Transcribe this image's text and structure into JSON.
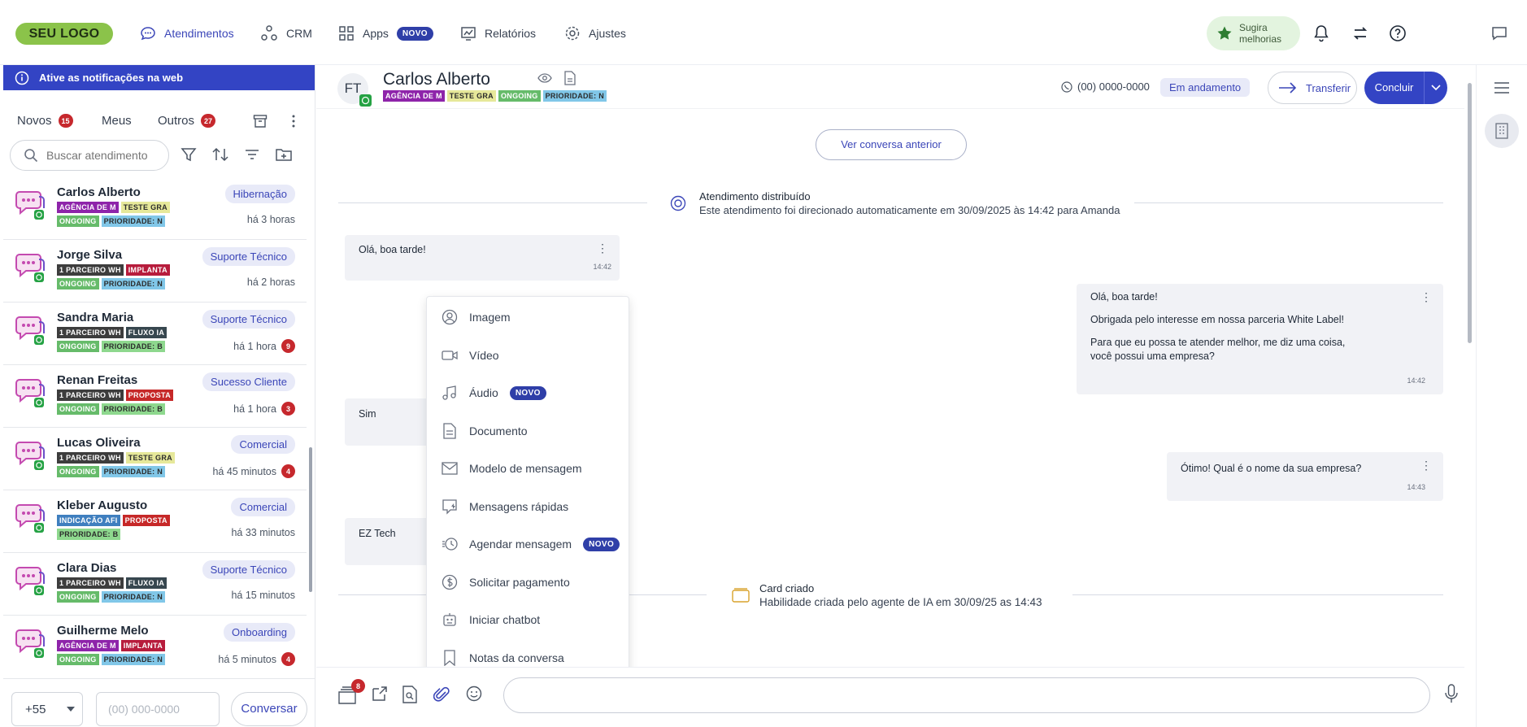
{
  "logo": "SEU LOGO",
  "nav": {
    "items": [
      {
        "label": "Atendimentos",
        "icon": "chat-bubble-icon",
        "active": true
      },
      {
        "label": "CRM",
        "icon": "nodes-icon"
      },
      {
        "label": "Apps",
        "icon": "grid-icon",
        "badge": "NOVO"
      },
      {
        "label": "Relatórios",
        "icon": "chart-icon"
      },
      {
        "label": "Ajustes",
        "icon": "gear-icon"
      }
    ],
    "suggest": {
      "line1": "Sugira",
      "line2": "melhorias"
    }
  },
  "notice": "Ative as notificações na web",
  "tabs": [
    {
      "label": "Novos",
      "count": "15"
    },
    {
      "label": "Meus"
    },
    {
      "label": "Outros",
      "count": "27"
    }
  ],
  "search": {
    "placeholder": "Buscar atendimento"
  },
  "conversations": [
    {
      "name": "Carlos Alberto",
      "tags": [
        "AGÊNCIA DE M",
        "TESTE GRA",
        "ONGOING",
        "PRIORIDADE: N"
      ],
      "status": "Hibernação",
      "time": "há 3 horas"
    },
    {
      "name": "Jorge Silva",
      "tags": [
        "1 PARCEIRO WH",
        "IMPLANTA",
        "ONGOING",
        "PRIORIDADE: N"
      ],
      "status": "Suporte Técnico",
      "time": "há 2 horas"
    },
    {
      "name": "Sandra Maria",
      "tags": [
        "1 PARCEIRO WH",
        "FLUXO IA",
        "ONGOING",
        "PRIORIDADE: B"
      ],
      "status": "Suporte Técnico",
      "time": "há 1 hora",
      "unread": "9"
    },
    {
      "name": "Renan Freitas",
      "tags": [
        "1 PARCEIRO WH",
        "PROPOSTA",
        "ONGOING",
        "PRIORIDADE: B"
      ],
      "status": "Sucesso Cliente",
      "time": "há 1 hora",
      "unread": "3"
    },
    {
      "name": "Lucas Oliveira",
      "tags": [
        "1 PARCEIRO WH",
        "TESTE GRA",
        "ONGOING",
        "PRIORIDADE: N"
      ],
      "status": "Comercial",
      "time": "há 45 minutos",
      "unread": "4"
    },
    {
      "name": "Kleber Augusto",
      "tags": [
        "INDICAÇÃO AFI",
        "PROPOSTA",
        "PRIORIDADE: B"
      ],
      "status": "Comercial",
      "time": "há 33 minutos"
    },
    {
      "name": "Clara Dias",
      "tags": [
        "1 PARCEIRO WH",
        "FLUXO IA",
        "ONGOING",
        "PRIORIDADE: N"
      ],
      "status": "Suporte Técnico",
      "time": "há 15 minutos"
    },
    {
      "name": "Guilherme Melo",
      "tags": [
        "AGÊNCIA DE M",
        "IMPLANTA",
        "ONGOING",
        "PRIORIDADE: N"
      ],
      "status": "Onboarding",
      "time": "há 5 minutos",
      "unread": "4"
    }
  ],
  "tag_colors": {
    "AGÊNCIA DE M": "#8e24aa",
    "TESTE GRA": "#e6e89a",
    "ONGOING": "#66bb6a",
    "PRIORIDADE: N": "#81c7e8",
    "PRIORIDADE: B": "#8ed88e",
    "1 PARCEIRO WH": "#3d3d3d",
    "IMPLANTA": "#b71c3c",
    "FLUXO IA": "#37474f",
    "PROPOSTA": "#c62828",
    "INDICAÇÃO AFI": "#3f7fbf"
  },
  "phone_bar": {
    "ddi": "+55",
    "placeholder": "(00) 000-0000",
    "button": "Conversar"
  },
  "chat": {
    "initials": "FT",
    "name": "Carlos Alberto",
    "tags": [
      "AGÊNCIA DE M",
      "TESTE GRA",
      "ONGOING",
      "PRIORIDADE: N"
    ],
    "phone": "(00) 0000-0000",
    "status": "Em andamento",
    "transfer": "Transferir",
    "finish": "Concluir",
    "prev_button": "Ver conversa anterior",
    "distributed": {
      "title": "Atendimento distribuído",
      "text": "Este atendimento foi direcionado automaticamente em 30/09/2025 às 14:42 para Amanda"
    },
    "card": {
      "title": "Card criado",
      "text": "Habilidade criada pelo agente de IA em 30/09/25 as 14:43"
    },
    "messages": [
      {
        "side": "in",
        "text": "Olá, boa tarde!",
        "time": "14:42"
      },
      {
        "side": "out",
        "lines": [
          "Olá, boa tarde!",
          "Obrigada pelo interesse em nossa parceria White Label!",
          "Para que eu possa te atender melhor, me diz uma coisa,",
          "você possui uma empresa?"
        ],
        "time": "14:42"
      },
      {
        "side": "in",
        "text": "Sim"
      },
      {
        "side": "out",
        "text": "Ótimo! Qual é o nome da sua empresa?",
        "time": "14:43"
      },
      {
        "side": "in",
        "text": "EZ Tech"
      }
    ],
    "attach_count": "8"
  },
  "attach_menu": [
    {
      "label": "Imagem",
      "icon": "image-icon"
    },
    {
      "label": "Vídeo",
      "icon": "video-icon"
    },
    {
      "label": "Áudio",
      "icon": "music-icon",
      "badge": "NOVO"
    },
    {
      "label": "Documento",
      "icon": "document-icon"
    },
    {
      "label": "Modelo de mensagem",
      "icon": "mail-icon"
    },
    {
      "label": "Mensagens rápidas",
      "icon": "quick-message-icon"
    },
    {
      "label": "Agendar mensagem",
      "icon": "schedule-icon",
      "badge": "NOVO"
    },
    {
      "label": "Solicitar pagamento",
      "icon": "payment-icon"
    },
    {
      "label": "Iniciar chatbot",
      "icon": "robot-icon"
    },
    {
      "label": "Notas da conversa",
      "icon": "bookmark-icon"
    }
  ]
}
